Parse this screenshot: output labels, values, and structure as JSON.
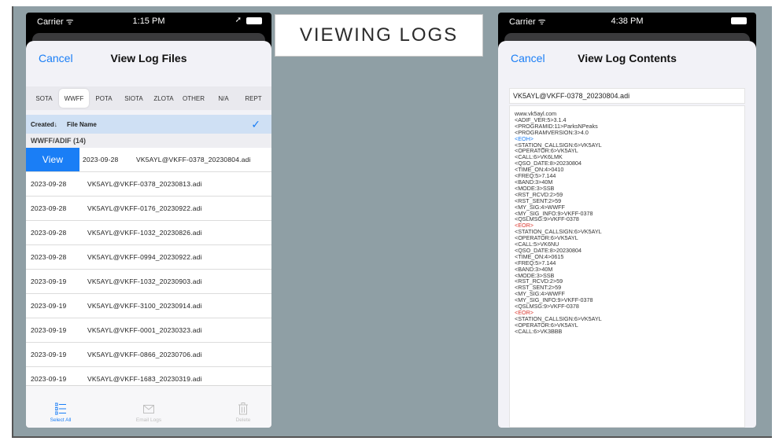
{
  "caption": "VIEWING LOGS",
  "phone1": {
    "status": {
      "carrier": "Carrier ᯤ",
      "time": "1:15 PM",
      "location": "➚"
    },
    "nav": {
      "cancel": "Cancel",
      "title": "View Log Files"
    },
    "segments": [
      "SOTA",
      "WWFF",
      "POTA",
      "SIOTA",
      "ZLOTA",
      "OTHER",
      "N/A",
      "REPT"
    ],
    "active_segment": "WWFF",
    "columns": {
      "created": "Created↓",
      "file_name": "File Name",
      "check": "✓"
    },
    "section": "WWFF/ADIF (14)",
    "view_button": "View",
    "rows": [
      {
        "date": "2023-09-28",
        "file": "VK5AYL@VKFF-0378_20230804.adi"
      },
      {
        "date": "2023-09-28",
        "file": "VK5AYL@VKFF-0378_20230813.adi"
      },
      {
        "date": "2023-09-28",
        "file": "VK5AYL@VKFF-0176_20230922.adi"
      },
      {
        "date": "2023-09-28",
        "file": "VK5AYL@VKFF-1032_20230826.adi"
      },
      {
        "date": "2023-09-28",
        "file": "VK5AYL@VKFF-0994_20230922.adi"
      },
      {
        "date": "2023-09-19",
        "file": "VK5AYL@VKFF-1032_20230903.adi"
      },
      {
        "date": "2023-09-19",
        "file": "VK5AYL@VKFF-3100_20230914.adi"
      },
      {
        "date": "2023-09-19",
        "file": "VK5AYL@VKFF-0001_20230323.adi"
      },
      {
        "date": "2023-09-19",
        "file": "VK5AYL@VKFF-0866_20230706.adi"
      },
      {
        "date": "2023-09-19",
        "file": "VK5AYL@VKFF-1683_20230319.adi"
      }
    ],
    "toolbar": {
      "select_all": "Select All",
      "email": "Email Logs",
      "delete": "Delete"
    }
  },
  "phone2": {
    "status": {
      "carrier": "Carrier ᯤ",
      "time": "4:38 PM"
    },
    "nav": {
      "cancel": "Cancel",
      "title": "View Log Contents"
    },
    "file_name": "VK5AYL@VKFF-0378_20230804.adi",
    "lines": [
      {
        "t": "www.vk5ayl.com",
        "c": ""
      },
      {
        "t": "<ADIF_VER:5>3.1.4",
        "c": ""
      },
      {
        "t": "<PROGRAMID:11>ParksNPeaks",
        "c": ""
      },
      {
        "t": "<PROGRAMVERSION:3>4.0",
        "c": ""
      },
      {
        "t": "<EOH>",
        "c": "blue"
      },
      {
        "t": "<STATION_CALLSIGN:6>VK5AYL",
        "c": ""
      },
      {
        "t": "<OPERATOR:6>VK5AYL",
        "c": ""
      },
      {
        "t": "<CALL:6>VK6LMK",
        "c": ""
      },
      {
        "t": "<QSO_DATE:8>20230804",
        "c": ""
      },
      {
        "t": "<TIME_ON:4>0410",
        "c": ""
      },
      {
        "t": "<FREQ:5>7.144",
        "c": ""
      },
      {
        "t": "<BAND:3>40M",
        "c": ""
      },
      {
        "t": "<MODE:3>SSB",
        "c": ""
      },
      {
        "t": "<RST_RCVD:2>59",
        "c": ""
      },
      {
        "t": "<RST_SENT:2>59",
        "c": ""
      },
      {
        "t": "<MY_SIG:4>WWFF",
        "c": ""
      },
      {
        "t": "<MY_SIG_INFO:9>VKFF-0378",
        "c": ""
      },
      {
        "t": "<QSLMSG:9>VKFF-0378",
        "c": ""
      },
      {
        "t": "<EOR>",
        "c": "red"
      },
      {
        "t": "<STATION_CALLSIGN:6>VK5AYL",
        "c": ""
      },
      {
        "t": "<OPERATOR:6>VK5AYL",
        "c": ""
      },
      {
        "t": "<CALL:5>VK6NU",
        "c": ""
      },
      {
        "t": "<QSO_DATE:8>20230804",
        "c": ""
      },
      {
        "t": "<TIME_ON:4>0615",
        "c": ""
      },
      {
        "t": "<FREQ:5>7.144",
        "c": ""
      },
      {
        "t": "<BAND:3>40M",
        "c": ""
      },
      {
        "t": "<MODE:3>SSB",
        "c": ""
      },
      {
        "t": "<RST_RCVD:2>59",
        "c": ""
      },
      {
        "t": "<RST_SENT:2>59",
        "c": ""
      },
      {
        "t": "<MY_SIG:4>WWFF",
        "c": ""
      },
      {
        "t": "<MY_SIG_INFO:9>VKFF-0378",
        "c": ""
      },
      {
        "t": "<QSLMSG:9>VKFF-0378",
        "c": ""
      },
      {
        "t": "<EOR>",
        "c": "red"
      },
      {
        "t": "<STATION_CALLSIGN:6>VK5AYL",
        "c": ""
      },
      {
        "t": "<OPERATOR:6>VK5AYL",
        "c": ""
      },
      {
        "t": "<CALL:6>VK3BBB",
        "c": ""
      }
    ]
  },
  "colors": {
    "accent": "#1a7ef6",
    "eor": "#d9342b",
    "slide_bg": "#8f9fa5"
  }
}
